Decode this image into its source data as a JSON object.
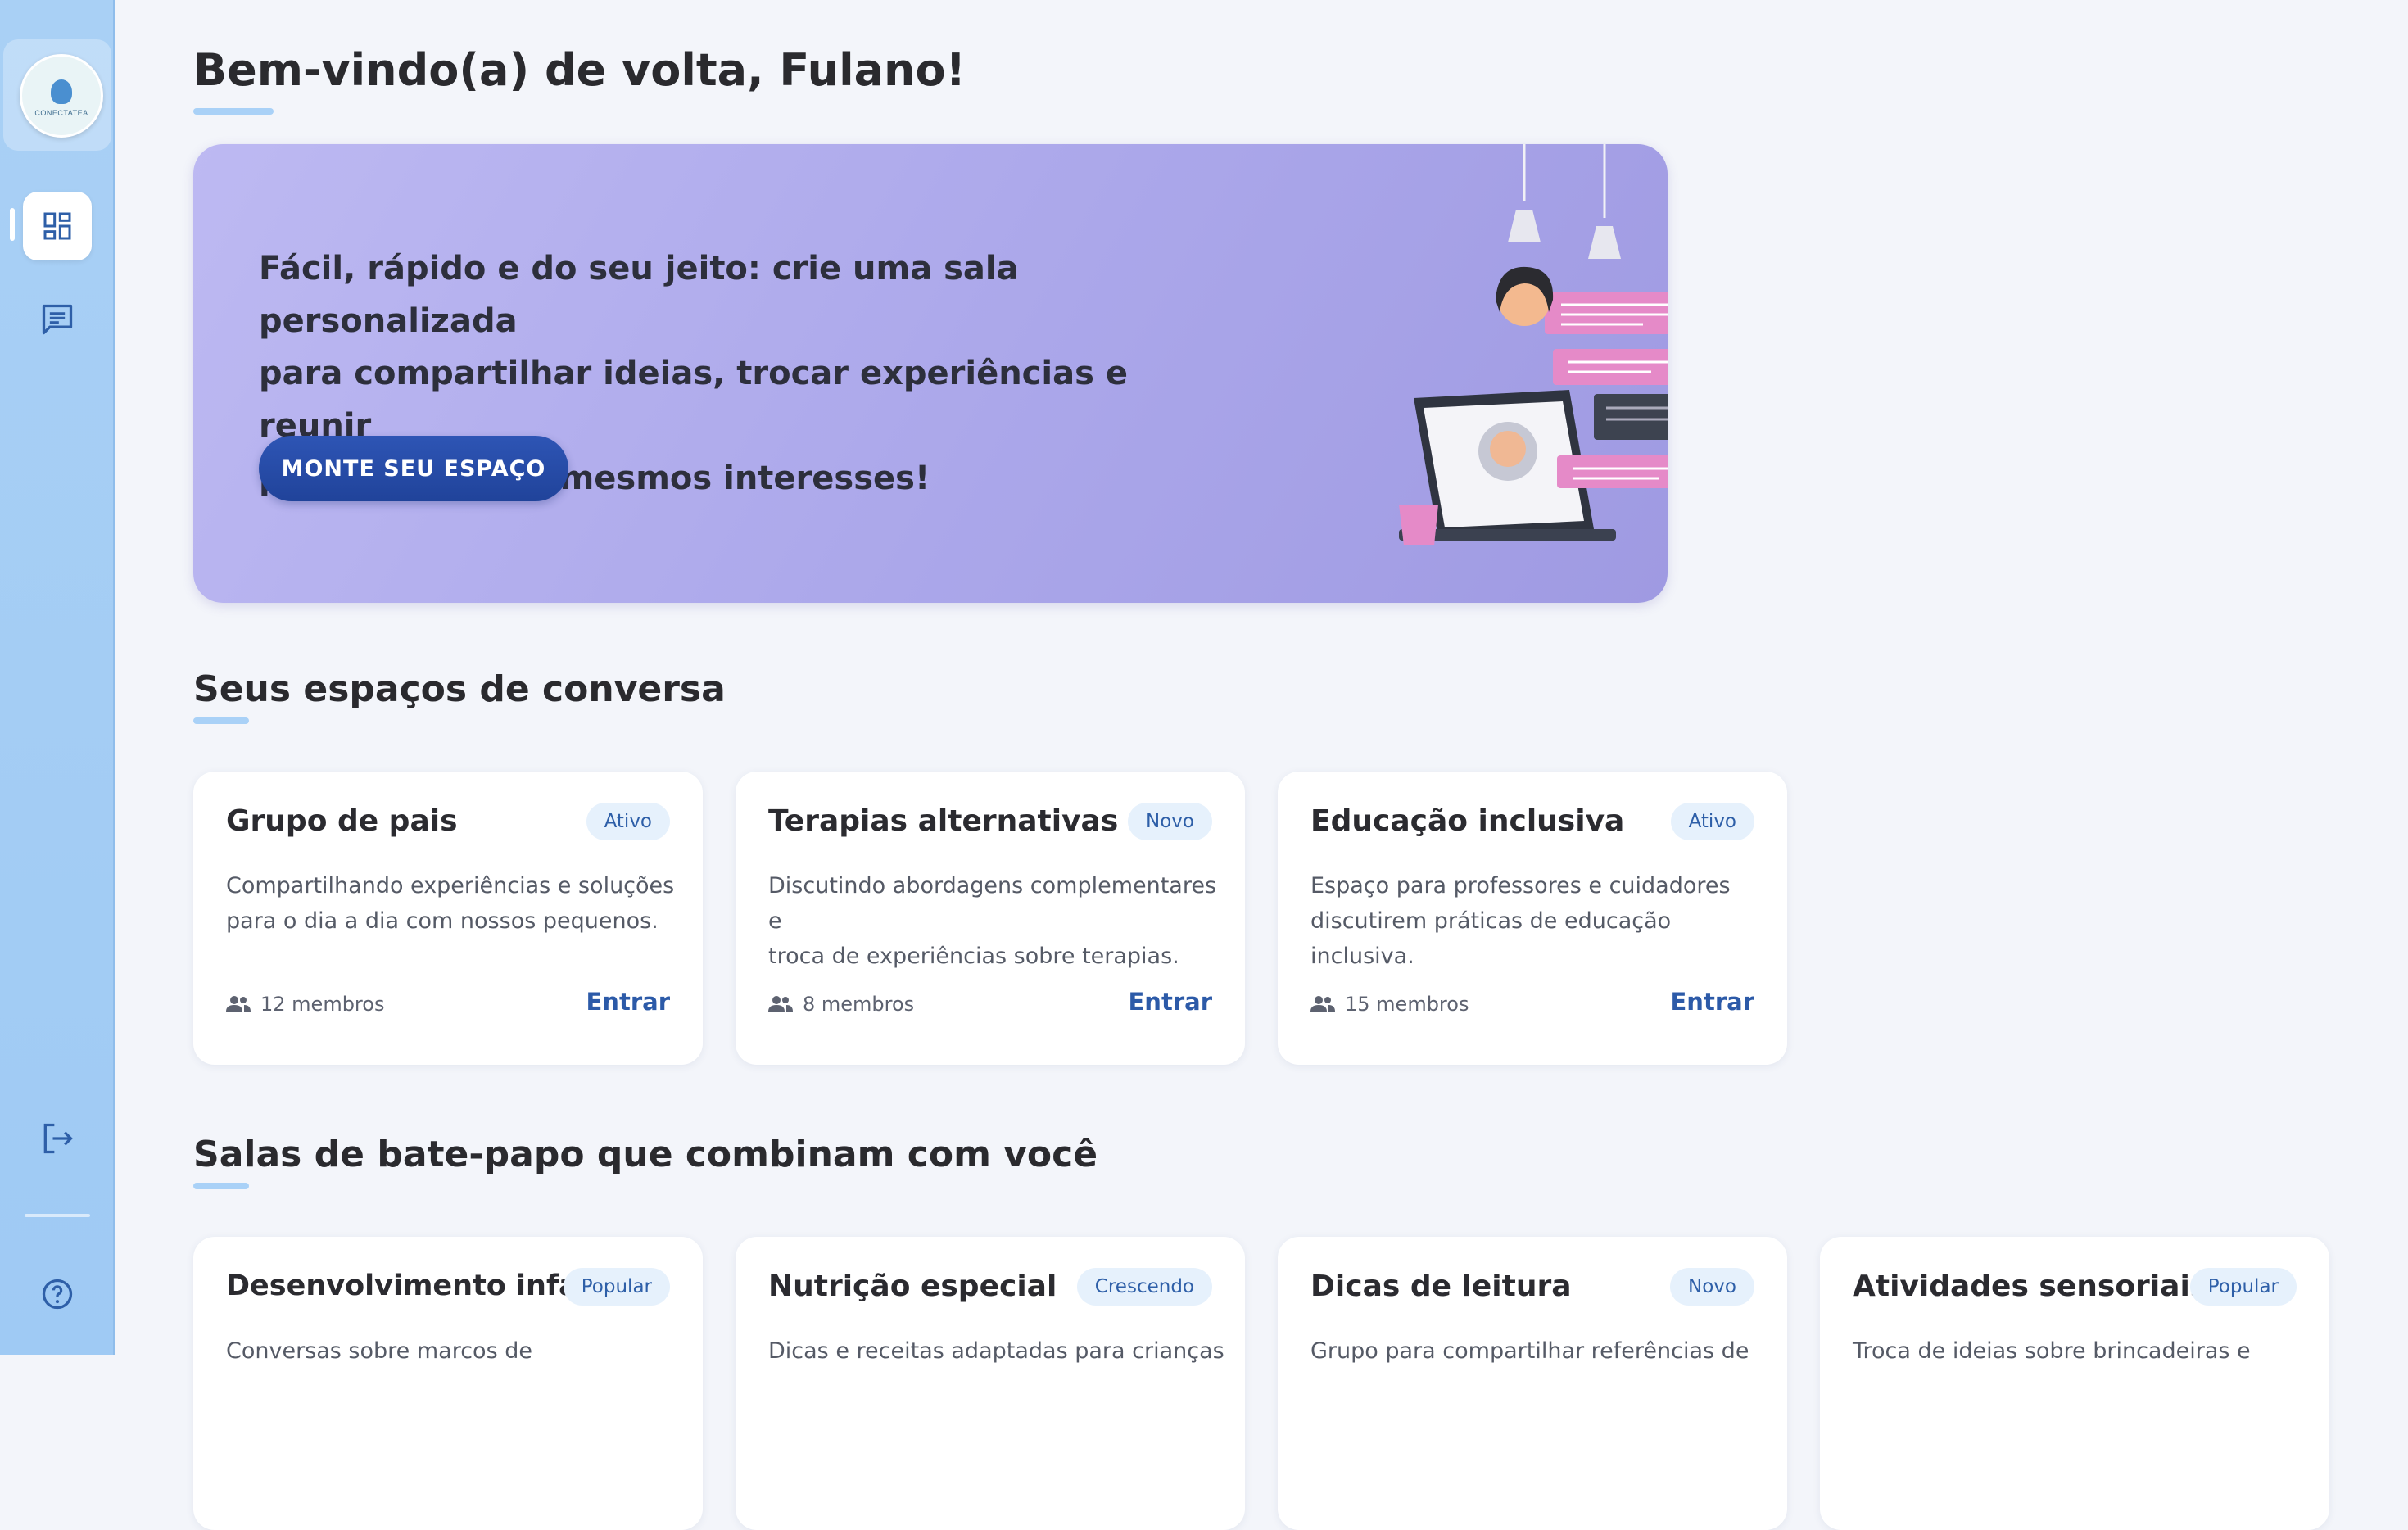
{
  "brand": {
    "logo_text": "CONECTATEA"
  },
  "sidebar": {
    "items": [
      {
        "name": "dashboard",
        "icon": "dashboard-icon",
        "active": true
      },
      {
        "name": "chat",
        "icon": "chat-icon",
        "active": false
      }
    ],
    "logout_icon": "logout-icon",
    "help_icon": "help-icon"
  },
  "header": {
    "title": "Bem-vindo(a) de volta, Fulano!"
  },
  "hero": {
    "line1": "Fácil, rápido e do seu jeito: crie uma sala personalizada",
    "line2": "para compartilhar ideias, trocar experiências e reunir",
    "line3": "pessoas com os mesmos interesses!",
    "button_label": "MONTE SEU ESPAÇO"
  },
  "spaces": {
    "title": "Seus espaços de conversa",
    "cards": [
      {
        "title": "Grupo de pais",
        "badge": "Ativo",
        "desc1": "Compartilhando experiências e soluções",
        "desc2": "para o dia a dia com nossos pequenos.",
        "members": "12 membros",
        "action": "Entrar"
      },
      {
        "title": "Terapias alternativas",
        "badge": "Novo",
        "desc1": "Discutindo abordagens complementares e",
        "desc2": "troca de experiências sobre terapias.",
        "members": "8 membros",
        "action": "Entrar"
      },
      {
        "title": "Educação inclusiva",
        "badge": "Ativo",
        "desc1": "Espaço para professores e cuidadores",
        "desc2": "discutirem práticas de educação inclusiva.",
        "members": "15 membros",
        "action": "Entrar"
      }
    ]
  },
  "rooms": {
    "title": "Salas de bate-papo que combinam com você",
    "cards": [
      {
        "title": "Desenvolvimento infantil",
        "badge": "Popular",
        "desc1": "Conversas sobre marcos de"
      },
      {
        "title": "Nutrição especial",
        "badge": "Crescendo",
        "desc1": "Dicas e receitas adaptadas para crianças"
      },
      {
        "title": "Dicas de leitura",
        "badge": "Novo",
        "desc1": "Grupo para compartilhar referências de"
      },
      {
        "title": "Atividades sensoriais",
        "badge": "Popular",
        "desc1": "Troca de ideias sobre brincadeiras e"
      }
    ]
  },
  "colors": {
    "sidebar": "#a9d0f5",
    "hero": "#aba7ea",
    "primary_button": "#2a4ea8",
    "link": "#2c5aa8",
    "badge_bg": "#e6f1fc",
    "accent_underline": "#a9d1f7"
  }
}
